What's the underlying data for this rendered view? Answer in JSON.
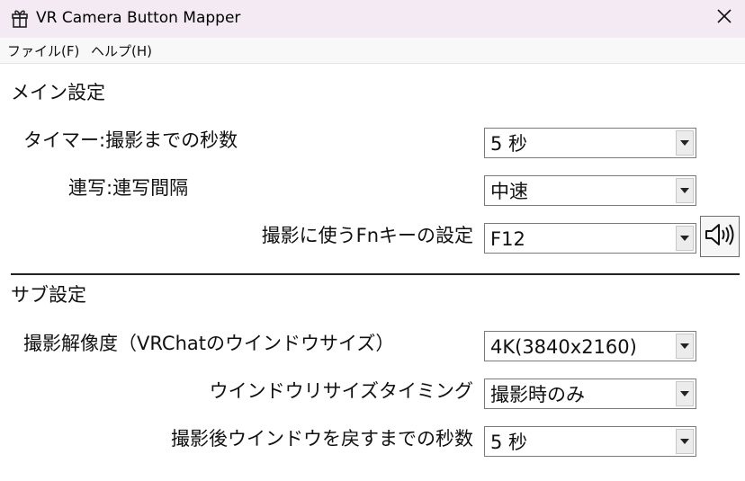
{
  "window": {
    "title": "VR Camera Button Mapper",
    "icon": "gift-icon",
    "close_icon": "close-icon"
  },
  "menu": {
    "items": [
      {
        "label": "ファイル(F)"
      },
      {
        "label": "ヘルプ(H)"
      }
    ]
  },
  "main_settings": {
    "title": "メイン設定",
    "timer": {
      "label": "タイマー:撮影までの秒数",
      "value": "5 秒"
    },
    "burst": {
      "label": "連写:連写間隔",
      "value": "中速"
    },
    "fn_key": {
      "label": "撮影に使うFnキーの設定",
      "value": "F12",
      "test_icon": "speaker-icon"
    }
  },
  "sub_settings": {
    "title": "サブ設定",
    "resolution": {
      "label": "撮影解像度（VRChatのウインドウサイズ）",
      "value": "4K(3840x2160)"
    },
    "resize_timing": {
      "label": "ウインドウリサイズタイミング",
      "value": "撮影時のみ"
    },
    "restore_delay": {
      "label": "撮影後ウインドウを戻すまでの秒数",
      "value": "5 秒"
    }
  },
  "colors": {
    "titlebar_bg": "#f4eaf3",
    "menubar_bg": "#f8f8f8",
    "border": "#7a7a7a"
  }
}
